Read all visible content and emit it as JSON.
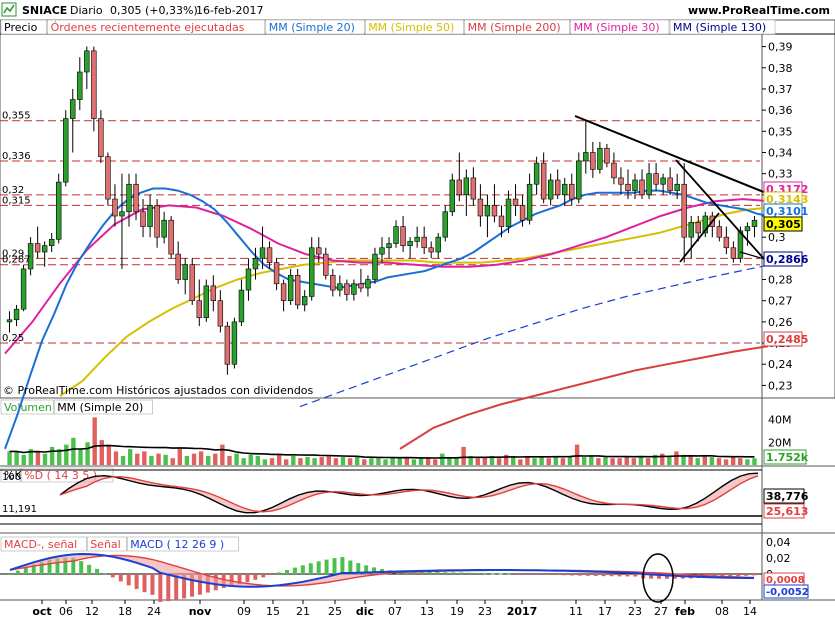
{
  "header": {
    "icon": "chart-icon",
    "ticker": "SNIACE",
    "period": "Diario",
    "quote": "0,305 (+0,33%)",
    "date": "16-feb-2017",
    "site": "www.ProRealTime.com"
  },
  "price_panel": {
    "legend": [
      {
        "label": "Precio",
        "color": "#000000"
      },
      {
        "label": "Órdenes recientemente ejecutadas",
        "color": "#e04040"
      },
      {
        "label": "MM (Simple 20)",
        "color": "#1a6fd4"
      },
      {
        "label": "MM (Simple 50)",
        "color": "#d4c000"
      },
      {
        "label": "MM (Simple 200)",
        "color": "#d84040"
      },
      {
        "label": "MM (Simple 30)",
        "color": "#e020a0"
      },
      {
        "label": "MM (Simple 130)",
        "color": "#00008b"
      }
    ],
    "copyright": "© ProRealTime.com  Históricos ajustados con dividendos",
    "left_levels": [
      "0,355",
      "0,336",
      "0,32",
      "0,315",
      "0,29",
      "0,287",
      "0,25"
    ],
    "right_ticks": [
      "0,39",
      "0,38",
      "0,37",
      "0,36",
      "0,35",
      "0,34",
      "0,33",
      "0,32",
      "0,31",
      "0,3",
      "0,29",
      "0,28",
      "0,27",
      "0,26",
      "0,25",
      "0,24",
      "0,23"
    ],
    "badges": [
      {
        "text": "0,3172",
        "color": "#e020a0"
      },
      {
        "text": "0,3143",
        "color": "#d4c000"
      },
      {
        "text": "0,3101",
        "color": "#1a6fd4"
      },
      {
        "text": "0,305",
        "color": "#000000"
      },
      {
        "text": "0,2866",
        "color": "#00008b"
      },
      {
        "text": "0,2485",
        "color": "#d84040"
      }
    ]
  },
  "volume_panel": {
    "legend": [
      {
        "label": "Volumen",
        "color": "#2ca02c"
      },
      {
        "label": "MM (Simple 20)",
        "color": "#000000"
      }
    ],
    "right_ticks": [
      "40M",
      "20M"
    ],
    "badge": "1.752k"
  },
  "stoch_panel": {
    "legend": [
      {
        "label": "%K",
        "color": "#000000"
      },
      {
        "label": "%D ( 14 3 5 )",
        "color": "#e04040"
      }
    ],
    "left_values": [
      "100",
      "11,191"
    ],
    "badges": [
      "38,776",
      "25,613"
    ]
  },
  "macd_panel": {
    "legend": [
      {
        "label": "MACD-, señal",
        "color": "#e04040"
      },
      {
        "label": "Señal",
        "color": "#e04040"
      },
      {
        "label": "MACD ( 12 26 9 )",
        "color": "#1a3fd4"
      }
    ],
    "right_ticks": [
      "0,04",
      "0,02",
      "0",
      "-0,02"
    ],
    "badges": [
      "0,0008",
      "-0,0052"
    ]
  },
  "x_axis": {
    "labels": [
      "oct",
      "06",
      "12",
      "18",
      "24",
      "nov",
      "09",
      "15",
      "21",
      "25",
      "dic",
      "07",
      "13",
      "19",
      "23",
      "2017",
      "11",
      "17",
      "23",
      "27",
      "feb",
      "08",
      "14"
    ]
  },
  "chart_data": {
    "type": "candlestick",
    "title": "SNIACE Diario",
    "ylim": [
      0.225,
      0.395
    ],
    "horizontal_levels": [
      0.355,
      0.336,
      0.32,
      0.315,
      0.29,
      0.287,
      0.25
    ],
    "series": [
      {
        "name": "Precio",
        "ohlc": [
          [
            0.26,
            0.265,
            0.255,
            0.261
          ],
          [
            0.261,
            0.268,
            0.258,
            0.266
          ],
          [
            0.266,
            0.287,
            0.265,
            0.285
          ],
          [
            0.285,
            0.3,
            0.282,
            0.297
          ],
          [
            0.297,
            0.305,
            0.29,
            0.293
          ],
          [
            0.293,
            0.298,
            0.286,
            0.296
          ],
          [
            0.296,
            0.302,
            0.293,
            0.299
          ],
          [
            0.299,
            0.33,
            0.297,
            0.326
          ],
          [
            0.326,
            0.36,
            0.324,
            0.356
          ],
          [
            0.356,
            0.37,
            0.34,
            0.365
          ],
          [
            0.365,
            0.385,
            0.36,
            0.378
          ],
          [
            0.378,
            0.39,
            0.37,
            0.388
          ],
          [
            0.388,
            0.39,
            0.35,
            0.356
          ],
          [
            0.356,
            0.36,
            0.335,
            0.338
          ],
          [
            0.338,
            0.34,
            0.315,
            0.318
          ],
          [
            0.318,
            0.325,
            0.305,
            0.31
          ],
          [
            0.31,
            0.33,
            0.285,
            0.312
          ],
          [
            0.312,
            0.33,
            0.305,
            0.325
          ],
          [
            0.325,
            0.33,
            0.308,
            0.312
          ],
          [
            0.312,
            0.318,
            0.3,
            0.305
          ],
          [
            0.305,
            0.32,
            0.3,
            0.315
          ],
          [
            0.315,
            0.318,
            0.295,
            0.3
          ],
          [
            0.3,
            0.312,
            0.297,
            0.308
          ],
          [
            0.308,
            0.31,
            0.29,
            0.292
          ],
          [
            0.292,
            0.298,
            0.278,
            0.28
          ],
          [
            0.28,
            0.29,
            0.273,
            0.287
          ],
          [
            0.287,
            0.29,
            0.268,
            0.27
          ],
          [
            0.27,
            0.28,
            0.258,
            0.262
          ],
          [
            0.262,
            0.28,
            0.26,
            0.277
          ],
          [
            0.277,
            0.282,
            0.265,
            0.27
          ],
          [
            0.27,
            0.275,
            0.255,
            0.258
          ],
          [
            0.258,
            0.26,
            0.235,
            0.24
          ],
          [
            0.24,
            0.262,
            0.238,
            0.26
          ],
          [
            0.26,
            0.28,
            0.258,
            0.275
          ],
          [
            0.275,
            0.29,
            0.27,
            0.285
          ],
          [
            0.285,
            0.295,
            0.28,
            0.29
          ],
          [
            0.29,
            0.305,
            0.285,
            0.295
          ],
          [
            0.295,
            0.298,
            0.285,
            0.288
          ],
          [
            0.288,
            0.29,
            0.275,
            0.278
          ],
          [
            0.278,
            0.28,
            0.265,
            0.27
          ],
          [
            0.27,
            0.285,
            0.268,
            0.282
          ],
          [
            0.282,
            0.285,
            0.266,
            0.268
          ],
          [
            0.268,
            0.275,
            0.265,
            0.272
          ],
          [
            0.272,
            0.3,
            0.27,
            0.295
          ],
          [
            0.295,
            0.3,
            0.288,
            0.292
          ],
          [
            0.292,
            0.295,
            0.28,
            0.282
          ],
          [
            0.282,
            0.285,
            0.272,
            0.275
          ],
          [
            0.275,
            0.282,
            0.272,
            0.278
          ],
          [
            0.278,
            0.28,
            0.27,
            0.273
          ],
          [
            0.273,
            0.28,
            0.27,
            0.278
          ],
          [
            0.278,
            0.285,
            0.274,
            0.276
          ],
          [
            0.276,
            0.282,
            0.272,
            0.28
          ],
          [
            0.28,
            0.295,
            0.278,
            0.292
          ],
          [
            0.292,
            0.3,
            0.288,
            0.295
          ],
          [
            0.295,
            0.3,
            0.29,
            0.297
          ],
          [
            0.297,
            0.308,
            0.295,
            0.305
          ],
          [
            0.305,
            0.31,
            0.293,
            0.296
          ],
          [
            0.296,
            0.3,
            0.29,
            0.298
          ],
          [
            0.298,
            0.305,
            0.295,
            0.3
          ],
          [
            0.3,
            0.305,
            0.292,
            0.295
          ],
          [
            0.295,
            0.298,
            0.29,
            0.293
          ],
          [
            0.293,
            0.302,
            0.29,
            0.3
          ],
          [
            0.3,
            0.315,
            0.298,
            0.312
          ],
          [
            0.312,
            0.33,
            0.31,
            0.327
          ],
          [
            0.327,
            0.34,
            0.317,
            0.32
          ],
          [
            0.32,
            0.332,
            0.31,
            0.328
          ],
          [
            0.328,
            0.333,
            0.315,
            0.318
          ],
          [
            0.318,
            0.325,
            0.305,
            0.31
          ],
          [
            0.31,
            0.32,
            0.3,
            0.315
          ],
          [
            0.315,
            0.325,
            0.307,
            0.31
          ],
          [
            0.31,
            0.315,
            0.3,
            0.305
          ],
          [
            0.305,
            0.322,
            0.302,
            0.318
          ],
          [
            0.318,
            0.325,
            0.31,
            0.315
          ],
          [
            0.315,
            0.32,
            0.305,
            0.308
          ],
          [
            0.308,
            0.33,
            0.306,
            0.325
          ],
          [
            0.325,
            0.338,
            0.32,
            0.335
          ],
          [
            0.335,
            0.34,
            0.316,
            0.318
          ],
          [
            0.318,
            0.33,
            0.315,
            0.327
          ],
          [
            0.327,
            0.332,
            0.318,
            0.32
          ],
          [
            0.32,
            0.328,
            0.315,
            0.325
          ],
          [
            0.325,
            0.33,
            0.315,
            0.318
          ],
          [
            0.318,
            0.34,
            0.316,
            0.336
          ],
          [
            0.336,
            0.355,
            0.33,
            0.34
          ],
          [
            0.34,
            0.345,
            0.328,
            0.332
          ],
          [
            0.332,
            0.345,
            0.33,
            0.342
          ],
          [
            0.342,
            0.344,
            0.333,
            0.335
          ],
          [
            0.335,
            0.34,
            0.325,
            0.328
          ],
          [
            0.328,
            0.333,
            0.32,
            0.325
          ],
          [
            0.325,
            0.332,
            0.318,
            0.322
          ],
          [
            0.322,
            0.33,
            0.318,
            0.327
          ],
          [
            0.327,
            0.332,
            0.318,
            0.32
          ],
          [
            0.32,
            0.335,
            0.318,
            0.33
          ],
          [
            0.33,
            0.335,
            0.322,
            0.325
          ],
          [
            0.325,
            0.33,
            0.32,
            0.328
          ],
          [
            0.328,
            0.333,
            0.32,
            0.322
          ],
          [
            0.322,
            0.33,
            0.318,
            0.325
          ],
          [
            0.325,
            0.335,
            0.288,
            0.3
          ],
          [
            0.3,
            0.31,
            0.29,
            0.307
          ],
          [
            0.307,
            0.31,
            0.298,
            0.302
          ],
          [
            0.302,
            0.312,
            0.3,
            0.31
          ],
          [
            0.31,
            0.312,
            0.3,
            0.305
          ],
          [
            0.305,
            0.308,
            0.298,
            0.3
          ],
          [
            0.3,
            0.305,
            0.292,
            0.295
          ],
          [
            0.295,
            0.298,
            0.288,
            0.29
          ],
          [
            0.29,
            0.305,
            0.288,
            0.303
          ],
          [
            0.303,
            0.307,
            0.296,
            0.305
          ],
          [
            0.305,
            0.31,
            0.3,
            0.308
          ]
        ]
      },
      {
        "name": "MM (Simple 20)",
        "values": [
          0.2,
          0.216,
          0.234,
          0.251,
          0.264,
          0.278,
          0.289,
          0.298,
          0.306,
          0.313,
          0.318,
          0.321,
          0.323,
          0.323,
          0.322,
          0.32,
          0.317,
          0.313,
          0.307,
          0.3,
          0.293,
          0.287,
          0.283,
          0.28,
          0.279,
          0.278,
          0.277,
          0.276,
          0.277,
          0.278,
          0.279,
          0.281,
          0.282,
          0.283,
          0.284,
          0.286,
          0.288,
          0.29,
          0.293,
          0.297,
          0.301,
          0.305,
          0.308,
          0.311,
          0.313,
          0.315,
          0.318,
          0.32,
          0.321,
          0.321,
          0.321,
          0.321,
          0.322,
          0.322,
          0.321,
          0.32,
          0.318,
          0.316,
          0.315,
          0.314,
          0.313,
          0.311,
          0.31
        ]
      },
      {
        "name": "MM (Simple 50)",
        "values": [
          0.225,
          0.232,
          0.243,
          0.253,
          0.26,
          0.266,
          0.271,
          0.276,
          0.28,
          0.283,
          0.285,
          0.287,
          0.288,
          0.289,
          0.289,
          0.289,
          0.289,
          0.288,
          0.288,
          0.288,
          0.289,
          0.29,
          0.292,
          0.294,
          0.296,
          0.298,
          0.3,
          0.302,
          0.305,
          0.308,
          0.311,
          0.313,
          0.314
        ]
      },
      {
        "name": "MM (Simple 200)",
        "values": [
          0.2,
          0.21,
          0.216,
          0.221,
          0.225,
          0.229,
          0.233,
          0.237,
          0.24,
          0.243,
          0.246,
          0.2485
        ]
      },
      {
        "name": "MM (Simple 30)",
        "values": [
          0.245,
          0.26,
          0.278,
          0.294,
          0.306,
          0.313,
          0.315,
          0.314,
          0.31,
          0.304,
          0.297,
          0.292,
          0.289,
          0.288,
          0.288,
          0.287,
          0.286,
          0.286,
          0.287,
          0.289,
          0.292,
          0.296,
          0.3,
          0.305,
          0.31,
          0.314,
          0.317,
          0.318,
          0.317
        ]
      },
      {
        "name": "MM (Simple 130)",
        "values": [
          0.22,
          0.228,
          0.236,
          0.244,
          0.252,
          0.259,
          0.266,
          0.272,
          0.277,
          0.282,
          0.2866
        ]
      }
    ],
    "volume": [
      12,
      12,
      9,
      14,
      12,
      10,
      16,
      14,
      18,
      24,
      14,
      20,
      42,
      22,
      18,
      12,
      8,
      14,
      10,
      12,
      8,
      10,
      9,
      6,
      14,
      8,
      10,
      12,
      8,
      10,
      18,
      8,
      10,
      6,
      9,
      8,
      5,
      6,
      10,
      5,
      8,
      6,
      7,
      6,
      7,
      8,
      6,
      7,
      6,
      7,
      5,
      6,
      6,
      5,
      6,
      7,
      6,
      5,
      6,
      6,
      5,
      10,
      7,
      6,
      16,
      8,
      6,
      7,
      8,
      6,
      9,
      8,
      5,
      7,
      6,
      8,
      6,
      7,
      6,
      8,
      18,
      7,
      8,
      6,
      7,
      6,
      6,
      7,
      6,
      8,
      6,
      9,
      10,
      8,
      12,
      9,
      8,
      6,
      8,
      7,
      6,
      5,
      7,
      6,
      5,
      6
    ],
    "stochastic": {
      "k_last": 38.776,
      "d_last": 25.613
    },
    "macd": {
      "macd_last": -0.0052,
      "signal_last": 0.0008
    }
  }
}
